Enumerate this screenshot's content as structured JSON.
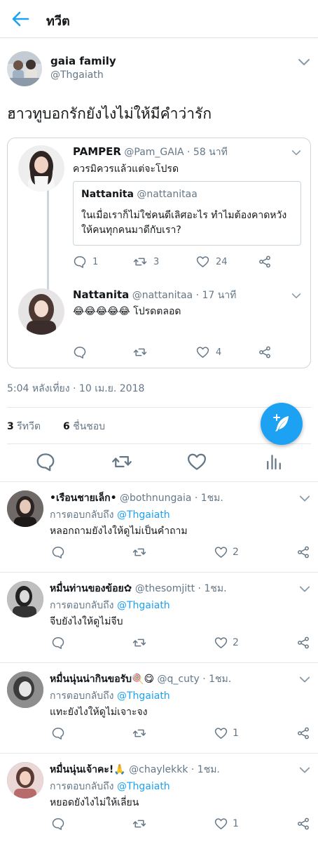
{
  "header": {
    "title": "ทวีต"
  },
  "main_tweet": {
    "name": "gaia family",
    "handle": "@Thgaiath",
    "text": "ฮาวทูบอกรักยังไงไม่ให้มีคำว่ารัก"
  },
  "quoted_thread": {
    "first": {
      "name": "PAMPER",
      "meta": "@Pam_GAIA · 58 นาที",
      "text": "ควรมิควรแล้วแต่จะโปรด",
      "inner_quote": {
        "name": "Nattanita",
        "handle": "@nattanitaa",
        "text": "ในเมื่อเราก็ไม่ใช่คนดีเลิศอะไร ทำไมต้องคาดหวังให้คนทุกคนมาดีกับเรา?"
      },
      "counts": {
        "reply": "1",
        "retweet": "3",
        "like": "24"
      }
    },
    "second": {
      "name": "Nattanita",
      "meta": "@nattanitaa · 17 นาที",
      "emoji": "😂😂😂😂😂",
      "text": "โปรดตลอด",
      "counts": {
        "like": "4"
      }
    }
  },
  "timestamp": "5:04 หลังเที่ยง · 10 เม.ย. 2018",
  "stats": {
    "retweets_count": "3",
    "retweets_label": "รีทวีต",
    "likes_count": "6",
    "likes_label": "ชื่นชอบ"
  },
  "replies": [
    {
      "name": "•เรือนชายเล็ก•",
      "meta": "@bothnungaia · 1ชม.",
      "reply_prefix": "การตอบกลับถึง",
      "reply_to": "@Thgaiath",
      "text": "หลอกถามยังไงให้ดูไม่เป็นคำถาม",
      "like_count": "2"
    },
    {
      "name": "หมื่นท่านของข้อย✿",
      "meta": "@thesomjitt · 1ชม.",
      "reply_prefix": "การตอบกลับถึง",
      "reply_to": "@Thgaiath",
      "text": "จีบยังไงให้ดูไม่จีบ",
      "like_count": "2"
    },
    {
      "name": "หมื่นนุ่นน่ากินขอรับ🍭😋",
      "meta": "@q_cuty · 1ชม.",
      "reply_prefix": "การตอบกลับถึง",
      "reply_to": "@Thgaiath",
      "text": "แทะยังไงให้ดูไม่เจาะจง",
      "like_count": "1"
    },
    {
      "name": "หมื่นนุ่นเจ้าคะ!🙏",
      "meta": "@chaylekkk · 1ชม.",
      "reply_prefix": "การตอบกลับถึง",
      "reply_to": "@Thgaiath",
      "text": "หยอดยังไงไม่ให้เลี่ยน",
      "like_count": "1"
    }
  ],
  "colors": {
    "accent": "#1da1f2",
    "text": "#14171a",
    "secondary": "#657786",
    "border": "#e1e8ed"
  }
}
